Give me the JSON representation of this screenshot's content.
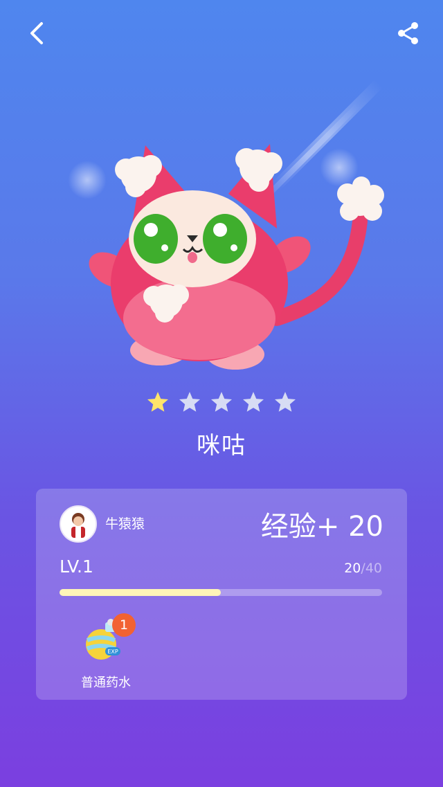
{
  "header": {
    "back_icon": "chevron-left-icon",
    "share_icon": "share-icon"
  },
  "pet": {
    "name": "咪咕",
    "stars_filled": 1,
    "stars_total": 5,
    "star_color_filled": "#ffe46a",
    "star_color_empty": "#d7dcf4"
  },
  "card": {
    "username": "牛猿猿",
    "exp_gain": "经验+ 20",
    "level": "LV.1",
    "progress_current": "20",
    "progress_separator": "/",
    "progress_max": "40",
    "progress_fraction": 0.5,
    "item": {
      "name": "普通药水",
      "count": "1",
      "icon": "exp-potion-icon"
    }
  }
}
